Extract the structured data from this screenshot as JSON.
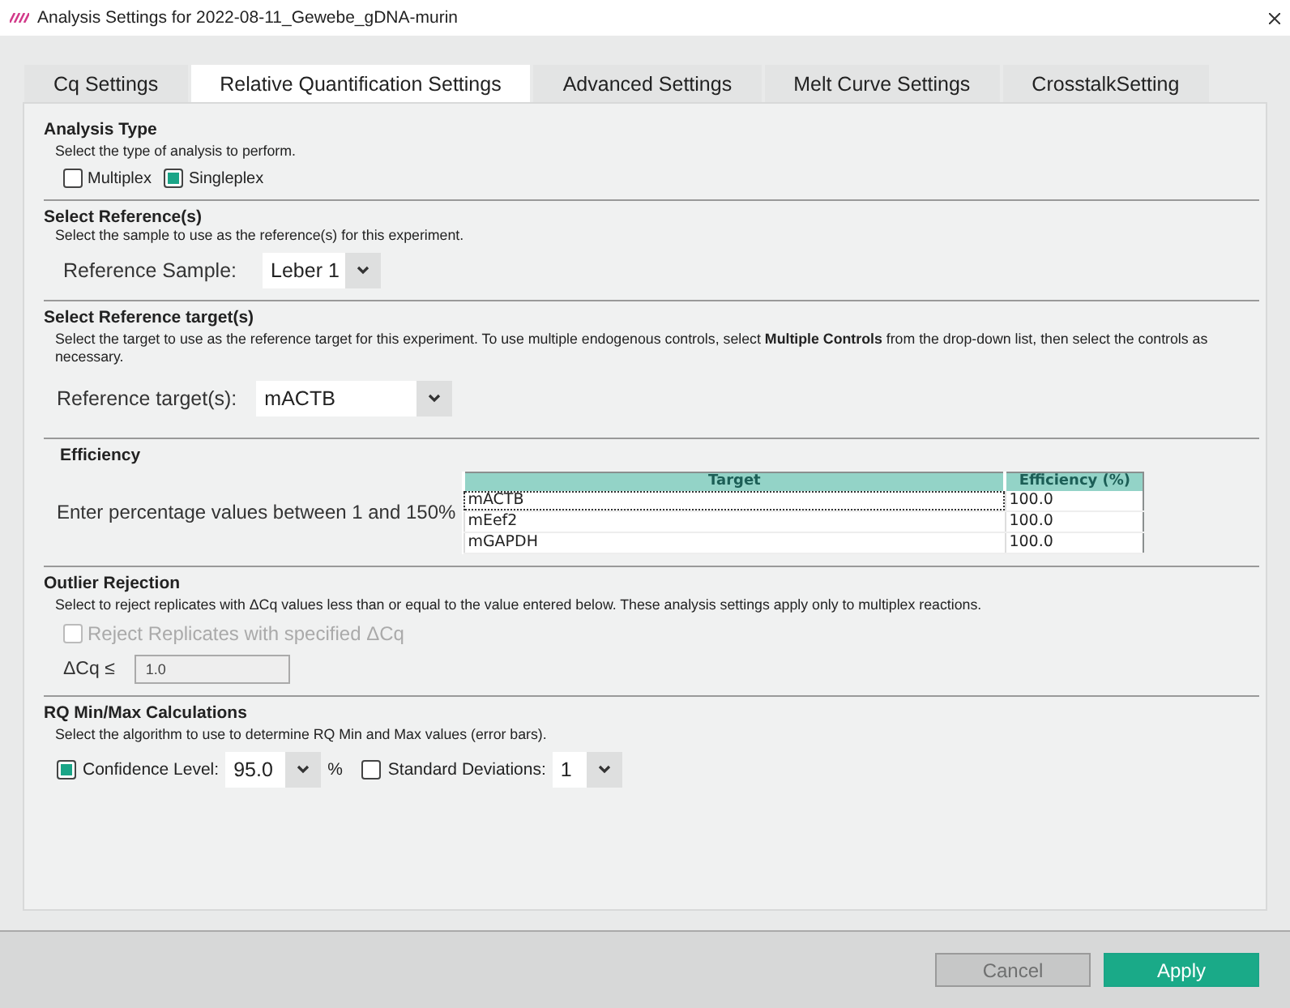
{
  "window": {
    "title": "Analysis Settings for 2022-08-11_Gewebe_gDNA-murin"
  },
  "tabs": [
    {
      "label": "Cq Settings",
      "selected": false
    },
    {
      "label": "Relative Quantification Settings",
      "selected": true
    },
    {
      "label": "Advanced Settings",
      "selected": false
    },
    {
      "label": "Melt Curve Settings",
      "selected": false
    },
    {
      "label": "CrosstalkSetting",
      "selected": false
    }
  ],
  "analysis_type": {
    "heading": "Analysis Type",
    "description": "Select the type of analysis to perform.",
    "options": [
      {
        "label": "Multiplex",
        "checked": false
      },
      {
        "label": "Singleplex",
        "checked": true
      }
    ]
  },
  "reference": {
    "heading": "Select Reference(s)",
    "description": "Select the sample to use as the reference(s) for this experiment.",
    "label": "Reference Sample:",
    "value": "Leber 1"
  },
  "reference_target": {
    "heading": "Select Reference target(s)",
    "description": "Select the target to use as the reference target for this experiment. To use multiple endogenous controls, select **Multiple Controls** from the drop-down list, then select the controls as necessary.",
    "label": "Reference target(s):",
    "value": "mACTB"
  },
  "efficiency": {
    "heading": "Efficiency",
    "instruction": "Enter percentage values between 1 and 150%",
    "table": {
      "columns": [
        "Target",
        "Efficiency (%)"
      ],
      "rows": [
        {
          "target": "mACTB",
          "efficiency": "100.0",
          "focused": true
        },
        {
          "target": "mEef2",
          "efficiency": "100.0",
          "focused": false
        },
        {
          "target": "mGAPDH",
          "efficiency": "100.0",
          "focused": false
        }
      ]
    }
  },
  "outlier": {
    "heading": "Outlier Rejection",
    "description": "Select to reject replicates with ΔCq values less than or equal to the value entered below. These analysis settings apply only to multiplex reactions.",
    "checkbox": {
      "label": "Reject Replicates with specified ΔCq",
      "checked": false,
      "disabled": true
    },
    "field": {
      "label": "ΔCq ≤",
      "value": "1.0",
      "disabled": true
    }
  },
  "rq": {
    "heading": "RQ Min/Max Calculations",
    "description": "Select the algorithm to use to determine RQ Min and Max values (error bars).",
    "options": [
      {
        "label": "Confidence Level:",
        "checked": true,
        "value": "95.0",
        "unit": "%"
      },
      {
        "label": "Standard Deviations:",
        "checked": false,
        "value": "1"
      }
    ]
  },
  "buttons": [
    {
      "label": "Cancel",
      "disabled": true,
      "primary": false
    },
    {
      "label": "Apply",
      "disabled": false,
      "primary": true
    }
  ]
}
